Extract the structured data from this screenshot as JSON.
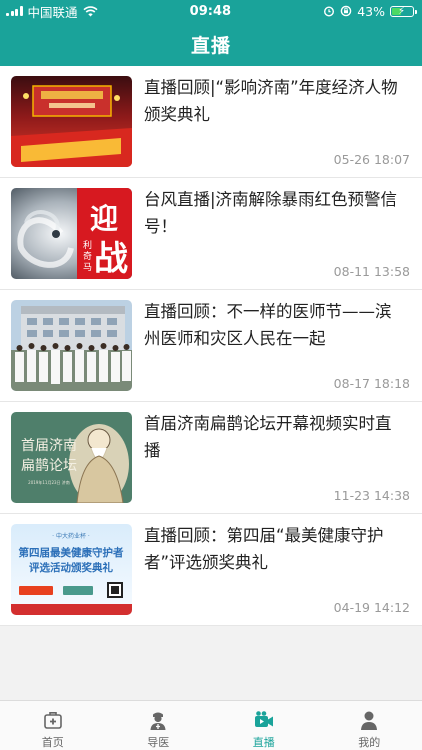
{
  "status_bar": {
    "carrier": "中国联通",
    "time": "09:48",
    "battery_percent": "43%",
    "battery_level": 0.43
  },
  "header": {
    "title": "直播"
  },
  "items": [
    {
      "title": "直播回顾|“影响济南”年度经济人物颁奖典礼",
      "time": "05-26 18:07"
    },
    {
      "title": "台风直播|济南解除暴雨红色预警信号！",
      "time": "08-11 13:58",
      "thumb_text": "迎战利奇马"
    },
    {
      "title": "直播回顾：不一样的医师节——滨州医师和灾区人民在一起",
      "time": "08-17 18:18"
    },
    {
      "title": "首届济南扁鹊论坛开幕视频实时直播",
      "time": "11-23 14:38",
      "thumb_text": "首届济南扁鹊论坛",
      "thumb_small": "2019年11月23日 济南"
    },
    {
      "title": "直播回顾：第四届“最美健康守护者”评选颁奖典礼",
      "time": "04-19 14:12",
      "thumb_top": "中大药业杯",
      "thumb_line1": "第四届最美健康守护者",
      "thumb_line2": "评选活动颁奖典礼"
    }
  ],
  "tabbar": {
    "tabs": [
      {
        "label": "首页",
        "icon": "medkit-icon"
      },
      {
        "label": "导医",
        "icon": "doctor-icon"
      },
      {
        "label": "直播",
        "icon": "video-icon"
      },
      {
        "label": "我的",
        "icon": "user-icon"
      }
    ],
    "active": "直播"
  },
  "colors": {
    "accent": "#1aa39a",
    "title_text": "#222222",
    "time_text": "#9a9a9a"
  }
}
